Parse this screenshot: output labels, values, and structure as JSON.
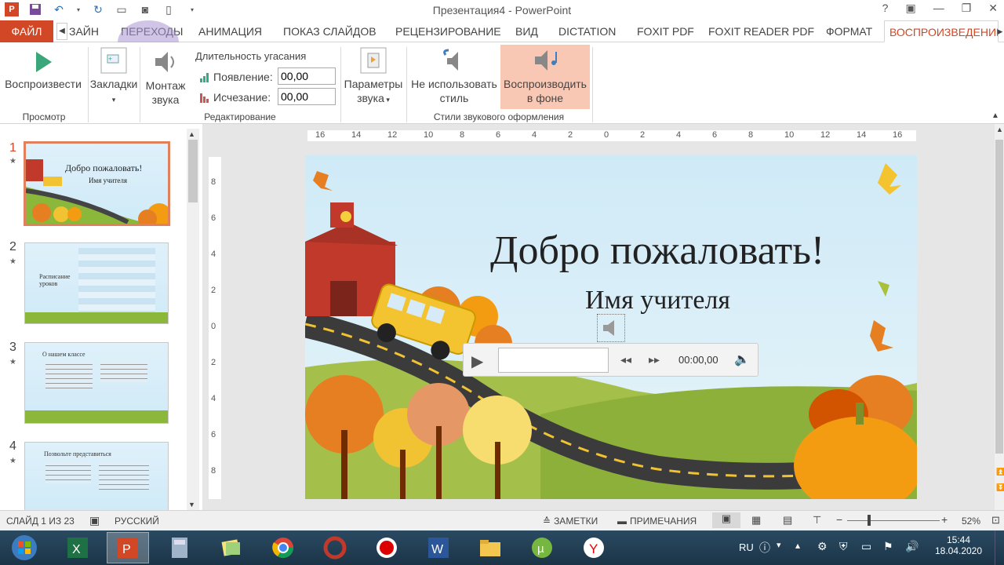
{
  "window": {
    "title": "Презентация4 - PowerPoint",
    "help": "?"
  },
  "tabs": [
    {
      "label": "ФАЙЛ"
    },
    {
      "label": "ЗАЙН"
    },
    {
      "label": "ПЕРЕХОДЫ"
    },
    {
      "label": "АНИМАЦИЯ"
    },
    {
      "label": "ПОКАЗ СЛАЙДОВ"
    },
    {
      "label": "РЕЦЕНЗИРОВАНИЕ"
    },
    {
      "label": "ВИД"
    },
    {
      "label": "DICTATION"
    },
    {
      "label": "FOXIT PDF"
    },
    {
      "label": "FOXIT READER PDF"
    },
    {
      "label": "ФОРМАТ"
    },
    {
      "label": "ВОСПРОИЗВЕДЕНИЕ"
    }
  ],
  "ribbon": {
    "play_label": "Воспроизвести",
    "bookmarks_label": "Закладки",
    "trim_line1": "Монтаж",
    "trim_line2": "звука",
    "fade_title": "Длительность угасания",
    "fade_in_label": "Появление:",
    "fade_in_value": "00,00",
    "fade_out_label": "Исчезание:",
    "fade_out_value": "00,00",
    "params_line1": "Параметры",
    "params_line2": "звука",
    "nostyle_line1": "Не использовать",
    "nostyle_line2": "стиль",
    "bg_line1": "Воспроизводить",
    "bg_line2": "в фоне",
    "group_preview": "Просмотр",
    "group_editing": "Редактирование",
    "group_styles": "Стили звукового оформления",
    "highlight_color": "#f9c8b5"
  },
  "thumbs": [
    {
      "num": "1",
      "title": "Добро пожаловать!",
      "subtitle": "Имя учителя"
    },
    {
      "num": "2",
      "title": "Расписание уроков"
    },
    {
      "num": "3",
      "title": "О нашем классе"
    },
    {
      "num": "4",
      "title": "Позвольте представиться"
    }
  ],
  "ruler": {
    "h": [
      "16",
      "14",
      "12",
      "10",
      "8",
      "6",
      "4",
      "2",
      "0",
      "2",
      "4",
      "6",
      "8",
      "10",
      "12",
      "14",
      "16"
    ],
    "v": [
      "8",
      "6",
      "4",
      "2",
      "0",
      "2",
      "4",
      "6",
      "8"
    ]
  },
  "slide": {
    "title": "Добро пожаловать!",
    "subtitle": "Имя учителя",
    "player_time": "00:00,00"
  },
  "status": {
    "slide_info": "СЛАЙД 1 ИЗ 23",
    "language": "РУССКИЙ",
    "notes": "ЗАМЕТКИ",
    "comments": "ПРИМЕЧАНИЯ",
    "zoom": "52%"
  },
  "taskbar": {
    "lang": "RU",
    "time": "15:44",
    "date": "18.04.2020"
  }
}
